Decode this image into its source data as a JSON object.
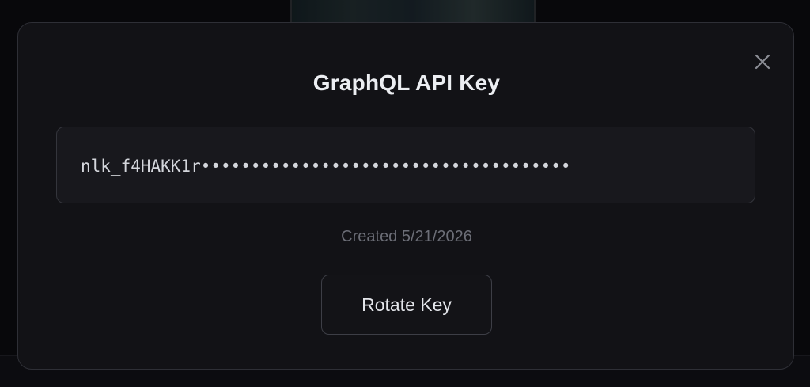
{
  "modal": {
    "title": "GraphQL API Key",
    "close_icon": "close-icon",
    "api_key_display": "nlk_f4HAKK1r•••••••••••••••••••••••••••••••••••••",
    "created_text": "Created 5/21/2026",
    "rotate_button_label": "Rotate Key"
  },
  "colors": {
    "modal_background": "#121216",
    "modal_border": "#2e2f36",
    "key_box_background": "#18181d",
    "title_text": "#eceef2",
    "muted_text": "#6c6e77"
  }
}
